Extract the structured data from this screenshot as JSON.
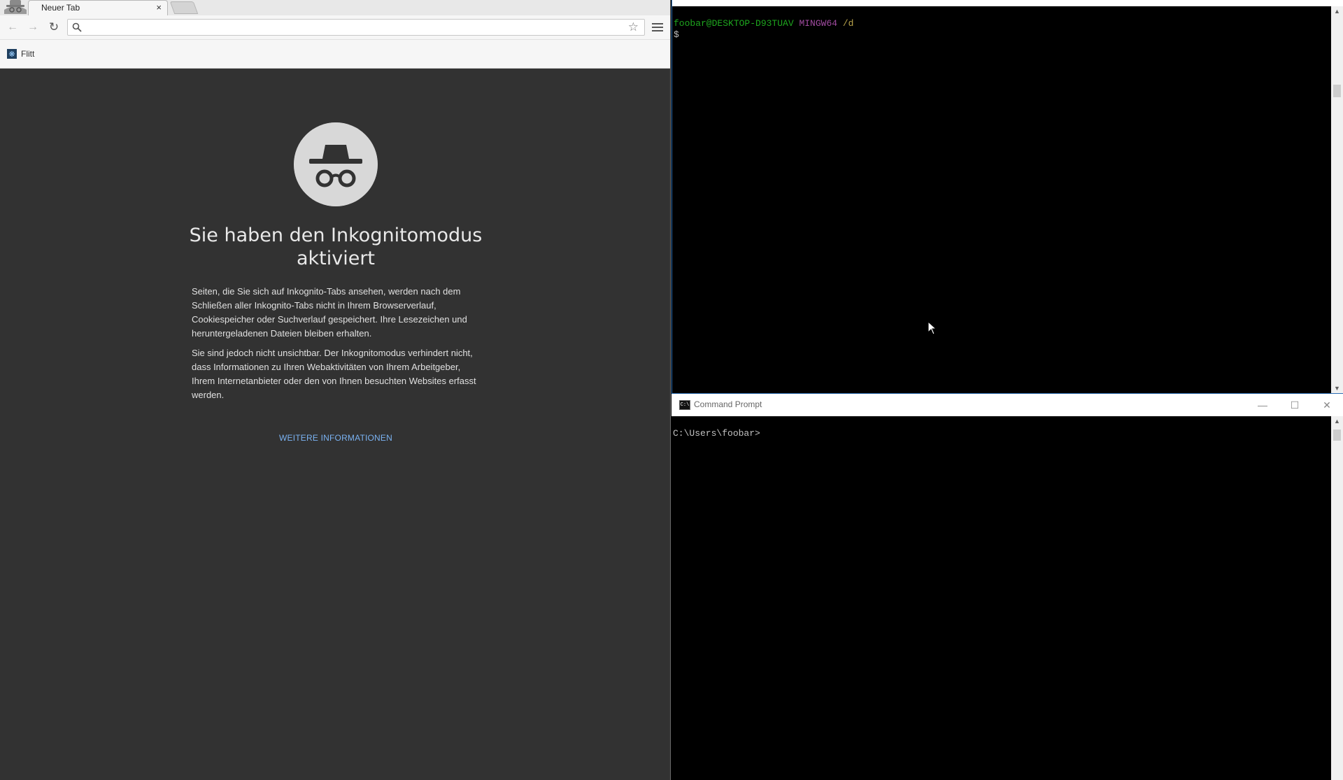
{
  "chrome": {
    "tab_title": "Neuer Tab",
    "tab_close": "×",
    "omnibox_value": "",
    "bookmarks": [
      {
        "label": "Flitt",
        "icon": "react-icon"
      }
    ],
    "incognito": {
      "heading": "Sie haben den Inkognitomodus aktiviert",
      "paragraph_1": "Seiten, die Sie sich auf Inkognito-Tabs ansehen, werden nach dem Schließen aller Inkognito-Tabs nicht in Ihrem Browserverlauf, Cookiespeicher oder Suchverlauf gespeichert. Ihre Lesezeichen und heruntergeladenen Dateien bleiben erhalten.",
      "paragraph_2": "Sie sind jedoch nicht unsichtbar. Der Inkognitomodus verhindert nicht, dass Informationen zu Ihren Webaktivitäten von Ihrem Arbeitgeber, Ihrem Internetanbieter oder den von Ihnen besuchten Websites erfasst werden.",
      "learn_more": "WEITERE INFORMATIONEN"
    },
    "colors": {
      "page_bg": "#323232",
      "link": "#7ab2f2"
    }
  },
  "bash": {
    "user_host": "foobar@DESKTOP-D93TUAV",
    "system": "MINGW64",
    "path": "/d",
    "prompt": "$"
  },
  "cmd": {
    "title": "Command Prompt",
    "prompt_line": "C:\\Users\\foobar>"
  }
}
